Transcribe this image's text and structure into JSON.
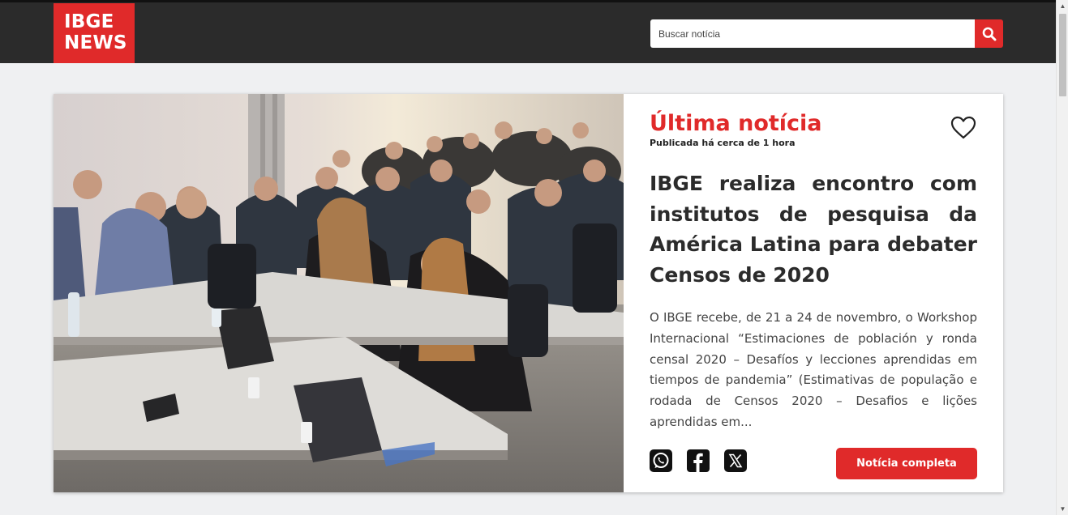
{
  "header": {
    "logo_line1": "IBGE",
    "logo_line2": "NEWS",
    "search": {
      "placeholder": "Buscar notícia",
      "icon": "search-icon"
    }
  },
  "article": {
    "label": "Última notícia",
    "published": "Publicada há cerca de 1 hora",
    "headline": "IBGE realiza encontro com institutos de pesquisa da América Latina para debater Censos de 2020",
    "summary": "O IBGE recebe, de 21 a 24 de novembro, o Workshop Internacional “Estimaciones de población y ronda censal 2020 – Desafíos y lecciones aprendidas em tiempos de pandemia” (Estimativas de população e rodada de Censos 2020 – Desafios e lições aprendidas em...",
    "full_button": "Notícia completa",
    "share_icons": [
      "whatsapp-icon",
      "facebook-icon",
      "x-icon"
    ],
    "favorite_icon": "heart-icon"
  },
  "colors": {
    "brand_red": "#e02a2a",
    "header_bg": "#2b2b2b",
    "page_bg": "#eff0f2"
  }
}
